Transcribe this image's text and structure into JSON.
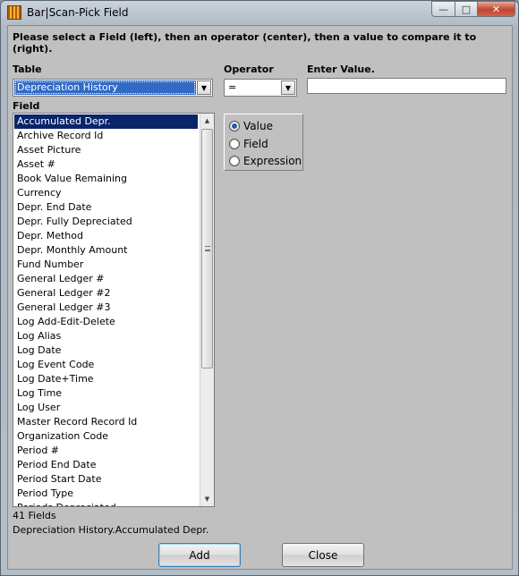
{
  "window": {
    "title": "Bar|Scan-Pick Field",
    "minimize_glyph": "—",
    "maximize_glyph": "□",
    "close_glyph": "✕"
  },
  "instruction": "Please select a Field (left), then an operator (center), then a value to compare it to (right).",
  "table": {
    "label": "Table",
    "selected": "Depreciation History"
  },
  "field": {
    "label": "Field",
    "selected_index": 0,
    "items": [
      "Accumulated Depr.",
      "Archive Record Id",
      "Asset Picture",
      "Asset #",
      "Book Value Remaining",
      "Currency",
      "Depr. End Date",
      "Depr. Fully Depreciated",
      "Depr. Method",
      "Depr. Monthly Amount",
      "Fund Number",
      "General Ledger #",
      "General Ledger #2",
      "General Ledger #3",
      "Log Add-Edit-Delete",
      "Log Alias",
      "Log Date",
      "Log Event Code",
      "Log Date+Time",
      "Log Time",
      "Log User",
      "Master Record Record Id",
      "Organization Code",
      "Period #",
      "Period End Date",
      "Period Start Date",
      "Period Type",
      "Periods Depreciated"
    ]
  },
  "operator": {
    "label": "Operator",
    "selected": "="
  },
  "value": {
    "label": "Enter Value.",
    "text": ""
  },
  "compare_mode": {
    "options": [
      "Value",
      "Field",
      "Expression"
    ],
    "selected": "Value"
  },
  "status": {
    "count": "41 Fields",
    "path": "Depreciation History.Accumulated Depr."
  },
  "buttons": {
    "add": "Add",
    "close": "Close"
  },
  "icons": {
    "dropdown": "chevron-down-icon",
    "scroll_up": "scroll-up-arrow-icon",
    "scroll_down": "scroll-down-arrow-icon"
  }
}
